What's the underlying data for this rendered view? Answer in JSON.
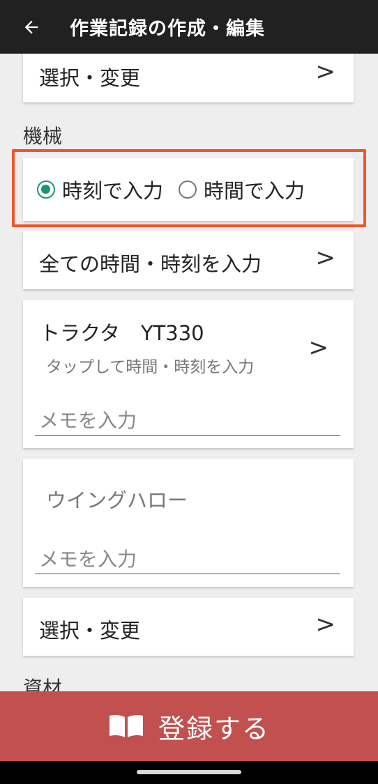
{
  "appbar": {
    "title": "作業記録の作成・編集",
    "back_icon": "arrow-left-icon"
  },
  "top_select": {
    "label": "選択・変更",
    "chevron": ">"
  },
  "machine_section": {
    "label": "機械",
    "input_mode": {
      "options": [
        "時刻で入力",
        "時間で入力"
      ],
      "selected": "時刻で入力"
    },
    "all_input": {
      "label": "全ての時間・時刻を入力",
      "chevron": ">"
    },
    "machines": [
      {
        "name": "トラクタ",
        "model": "YT330",
        "subtitle": "タップして時間・時刻を入力",
        "chevron": ">",
        "memo_placeholder": "メモを入力"
      },
      {
        "name": "ウイングハロー",
        "memo_placeholder": "メモを入力"
      }
    ],
    "select_change": {
      "label": "選択・変更",
      "chevron": ">"
    }
  },
  "materials_section": {
    "label": "資材"
  },
  "register_button": {
    "label": "登録する",
    "icon": "open-book-icon"
  },
  "colors": {
    "appbar": "#212121",
    "accent_radio": "#1a9475",
    "highlight": "#f0552b",
    "register": "#c2504f"
  }
}
